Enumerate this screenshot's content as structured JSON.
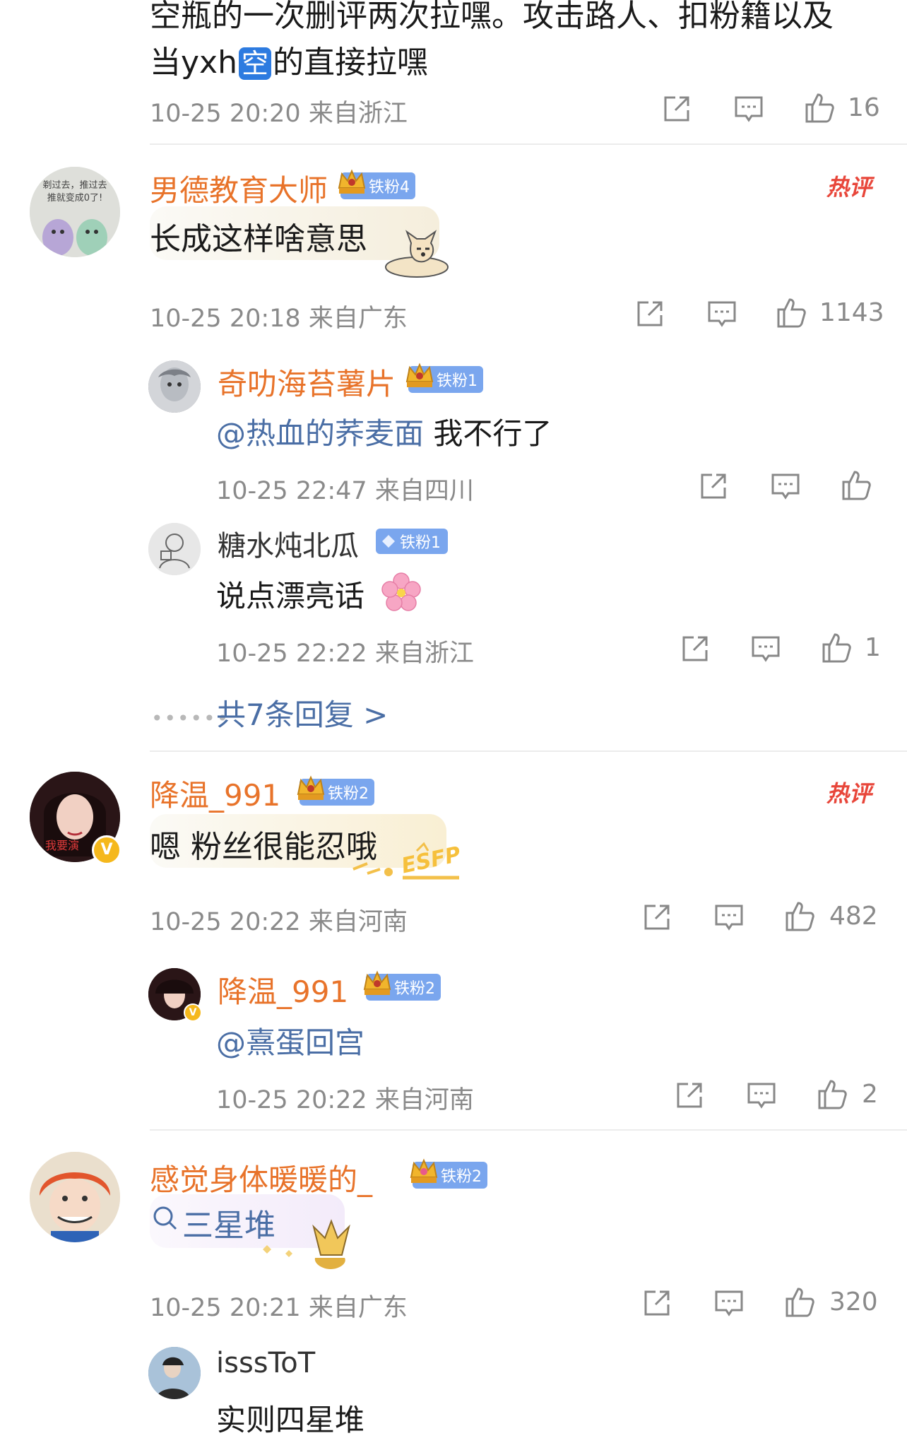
{
  "top_comment": {
    "text_line1": "空瓶的一次删评两次拉嘿。攻击路人、扣粉籍以及",
    "text_line2_prefix": "当yxh",
    "text_line2_emoji": "空",
    "text_line2_suffix": "的直接拉嘿",
    "meta": "10-25 20:20 来自浙江",
    "likes": "16"
  },
  "comments": [
    {
      "name": "男德教育大师",
      "badge": "铁粉4",
      "hot_label": "热评",
      "text": "长成这样啥意思",
      "meta": "10-25 20:18 来自广东",
      "likes": "1143",
      "avatar_text": "剃过去，推过去\n推就变成0了!",
      "replies": [
        {
          "name": "奇叻海苔薯片",
          "badge": "铁粉1",
          "mention": "@热血的荞麦面",
          "text": " 我不行了",
          "meta": "10-25 22:47 来自四川",
          "likes": ""
        },
        {
          "name": "糖水炖北瓜",
          "badge": "铁粉1",
          "text": "说点漂亮话",
          "meta": "10-25 22:22 来自浙江",
          "likes": "1"
        }
      ],
      "more_replies": "共7条回复 >"
    },
    {
      "name": "降温_991",
      "badge": "铁粉2",
      "hot_label": "热评",
      "text": "嗯 粉丝很能忍哦",
      "sticker_text": "ESFP",
      "meta": "10-25 20:22 来自河南",
      "likes": "482",
      "replies": [
        {
          "name": "降温_991",
          "badge": "铁粉2",
          "mention": "@熹蛋回宫",
          "text": "",
          "meta": "10-25 20:22 来自河南",
          "likes": "2"
        }
      ]
    },
    {
      "name": "感觉身体暖暖的_",
      "badge": "铁粉2",
      "search_text": "三星堆",
      "meta": "10-25 20:21 来自广东",
      "likes": "320",
      "replies": [
        {
          "name": "isssToT",
          "text": "实则四星堆"
        }
      ]
    }
  ],
  "colors": {
    "name_orange": "#e8732a",
    "link_blue": "#4a6ea5",
    "badge_blue": "#7aa6ee",
    "hot_red": "#e8463a",
    "meta_gray": "#8a8a8a"
  }
}
